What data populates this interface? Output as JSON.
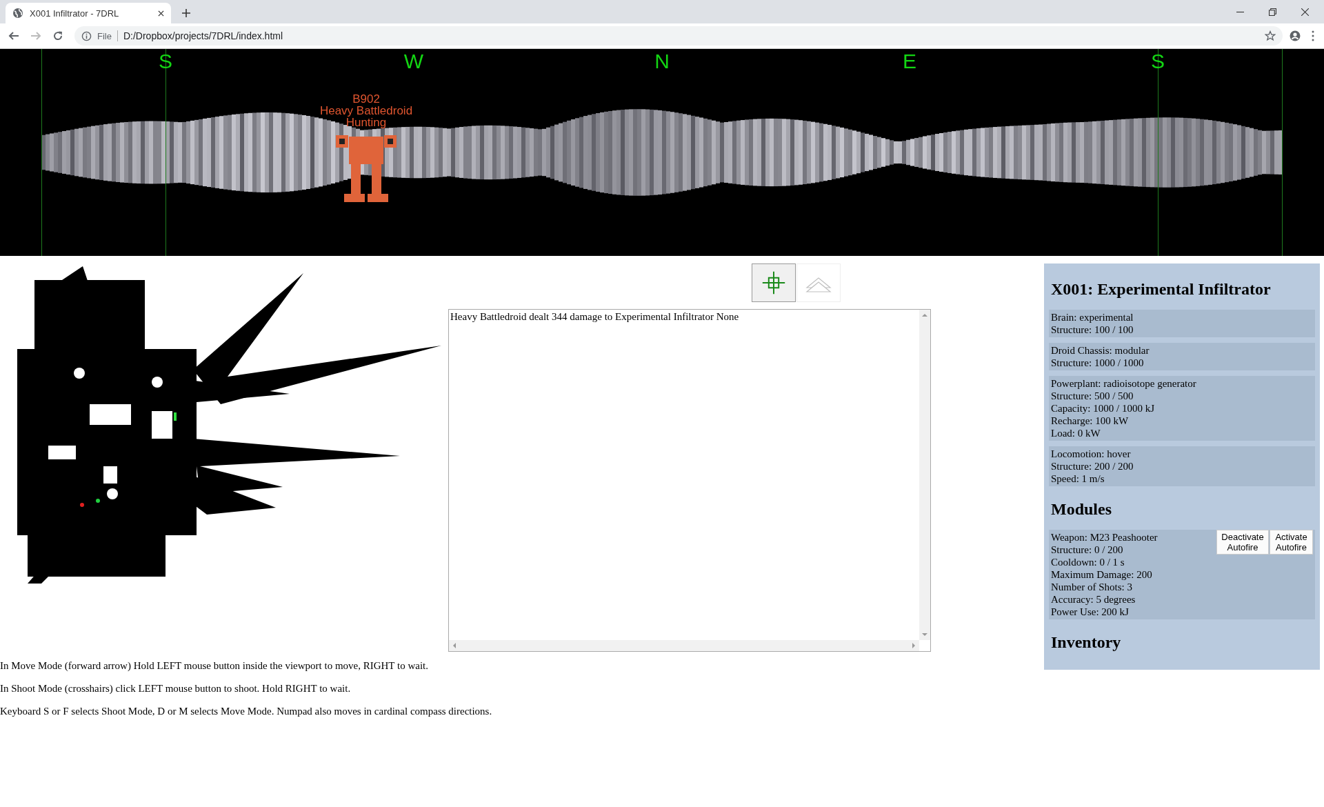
{
  "browser": {
    "tab_title": "X001 Infiltrator - 7DRL",
    "address_label": "File",
    "url": "D:/Dropbox/projects/7DRL/index.html"
  },
  "viewport": {
    "compass": [
      "S",
      "W",
      "N",
      "E",
      "S"
    ],
    "enemy": {
      "id": "B902",
      "name": "Heavy Battledroid",
      "status": "Hunting"
    }
  },
  "mode_buttons": [
    {
      "kind": "shoot",
      "selected": true
    },
    {
      "kind": "move",
      "selected": false
    }
  ],
  "log": [
    "Heavy Battledroid dealt 344 damage to Experimental Infiltrator None"
  ],
  "droid": {
    "title": "X001: Experimental Infiltrator",
    "components": [
      {
        "lines": [
          "Brain: experimental",
          "Structure: 100 / 100"
        ]
      },
      {
        "lines": [
          "Droid Chassis: modular",
          "Structure: 1000 / 1000"
        ]
      },
      {
        "lines": [
          "Powerplant: radioisotope generator",
          "Structure: 500 / 500",
          "Capacity: 1000 / 1000 kJ",
          "Recharge: 100 kW",
          "Load: 0 kW"
        ]
      },
      {
        "lines": [
          "Locomotion: hover",
          "Structure: 200 / 200",
          "Speed: 1 m/s"
        ]
      }
    ],
    "modules_heading": "Modules",
    "modules": [
      {
        "lines": [
          "Weapon: M23 Peashooter",
          "Structure: 0 / 200",
          "Cooldown: 0 / 1 s",
          "Maximum Damage: 200",
          "Number of Shots: 3",
          "Accuracy: 5 degrees",
          "Power Use: 200 kJ"
        ],
        "buttons": [
          "Deactivate Autofire",
          "Activate Autofire"
        ]
      }
    ],
    "inventory_heading": "Inventory"
  },
  "instructions": [
    "In Move Mode (forward arrow) Hold LEFT mouse button inside the viewport to move, RIGHT to wait.",
    "In Shoot Mode (crosshairs) click LEFT mouse button to shoot. Hold RIGHT to wait.",
    "Keyboard S or F selects Shoot Mode, D or M selects Move Mode. Numpad also moves in cardinal compass directions."
  ]
}
